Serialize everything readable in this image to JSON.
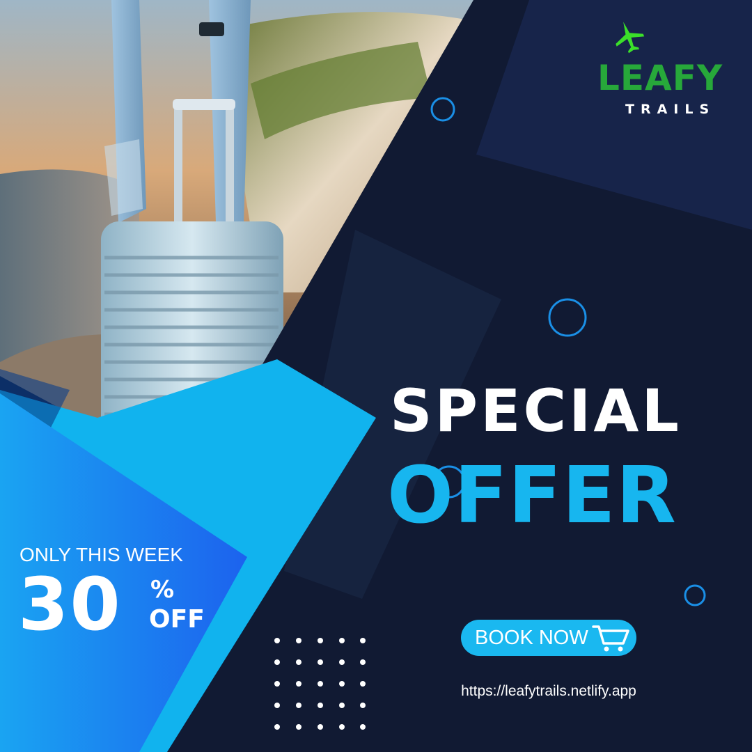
{
  "logo": {
    "word": "LEAFY",
    "sub": "TRAILS",
    "icons": [
      "plane-icon"
    ],
    "color": "#27a83a"
  },
  "headline": {
    "line1": "SPECIAL",
    "line2": "OFFER",
    "accent": "#17b6ef"
  },
  "promo": {
    "period": "ONLY THIS WEEK",
    "discount": "30",
    "percent_sign": "%",
    "off": "OFF"
  },
  "cta": {
    "label": "BOOK NOW",
    "icon": "cart-icon"
  },
  "website": "https://leafytrails.netlify.app",
  "colors": {
    "background": "#111a33",
    "panel": "#162446",
    "blue": "#17b6ef",
    "deep_blue": "#1e6ff0"
  }
}
